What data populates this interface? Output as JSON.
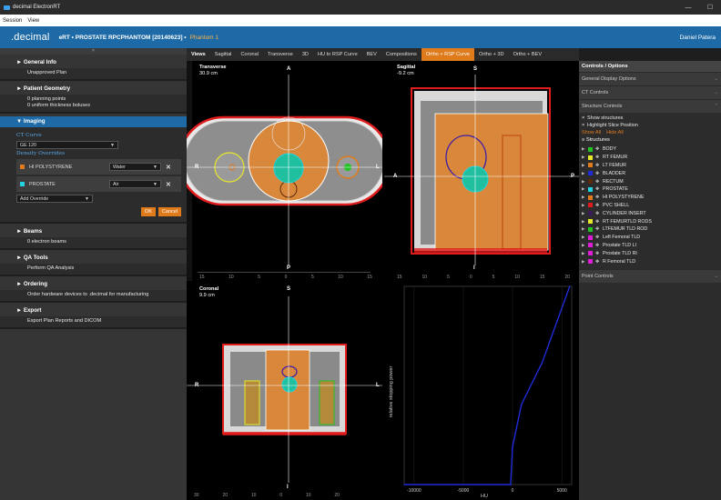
{
  "window": {
    "title": "decimal ElectronRT",
    "min": "—",
    "max": "☐"
  },
  "menu": [
    "Session",
    "View"
  ],
  "appbar": {
    "logo": ".decimal",
    "breadcrumb": "eRT  •  PROSTATE RPCPHANTOM [20140623]  •",
    "phantom": "Phantom 1",
    "user": "Daniel Patera"
  },
  "sidebar": {
    "general_info": {
      "title": "General Info",
      "body": "Unapproved Plan"
    },
    "patient_geometry": {
      "title": "Patient Geometry",
      "lines": [
        "0 planning points",
        "0 uniform thickness boluses"
      ]
    },
    "imaging": {
      "title": "Imaging",
      "ct_curve_label": "CT Curve",
      "ct_curve_value": "GE 120",
      "density_label": "Density Overrides",
      "overrides": [
        {
          "name": "HI POLYSTYRENE",
          "color": "#e07b1c",
          "value": "Water"
        },
        {
          "name": "PROSTATE",
          "color": "#22d3e0",
          "value": "Air"
        }
      ],
      "add_override": "Add Override",
      "ok": "OK",
      "cancel": "Cancel"
    },
    "beams": {
      "title": "Beams",
      "body": "0 electron beams"
    },
    "qa_tools": {
      "title": "QA Tools",
      "body": "Perform QA Analysis"
    },
    "ordering": {
      "title": "Ordering",
      "body": "Order hardware devices to .decimal for manufacturing"
    },
    "export": {
      "title": "Export",
      "body": "Export Plan Reports and DICOM"
    }
  },
  "tabs": [
    "Views",
    "Sagittal",
    "Coronal",
    "Transverse",
    "3D",
    "HU to RSP Curve",
    "BEV",
    "Compositions",
    "Ortho + RSP Curve",
    "Ortho + 3D",
    "Ortho + BEV"
  ],
  "active_tab": "Ortho + RSP Curve",
  "panes": {
    "transverse": {
      "name": "Transverse",
      "pos": "30.9 cm",
      "top": "A",
      "bottom": "P",
      "left": "R",
      "right": "L"
    },
    "sagittal": {
      "name": "Sagittal",
      "pos": "-9.2 cm",
      "top": "S",
      "bottom": "I",
      "left": "A",
      "right": "P"
    },
    "coronal": {
      "name": "Coronal",
      "pos": "9.9 cm",
      "top": "S",
      "bottom": "I",
      "left": "R",
      "right": "L"
    }
  },
  "transverse_ticks": [
    "15",
    "10",
    "5",
    "0",
    "5",
    "10",
    "15"
  ],
  "sagittal_ticks": [
    "15",
    "10",
    "5",
    "0",
    "5",
    "10",
    "15",
    "20"
  ],
  "coronal_ticks": [
    "30",
    "20",
    "10",
    "0",
    "10",
    "20"
  ],
  "chart_data": {
    "type": "line",
    "xlabel": "HU",
    "ylabel": "relative stopping power",
    "xticks": [
      "-10000",
      "-5000",
      "0",
      "5000"
    ],
    "x": [
      -11000,
      -200,
      0,
      900,
      3000,
      5800
    ],
    "y": [
      0.0,
      0.0,
      0.5,
      1.05,
      1.6,
      2.6
    ],
    "xlim": [
      -11000,
      6000
    ],
    "ylim": [
      0,
      2.6
    ],
    "color": "#1f2bd6"
  },
  "right_panel": {
    "title": "Controls / Options",
    "general_display": "General Display Options",
    "ct_controls": "CT Controls",
    "structure_controls": "Structure Controls",
    "show_structures": "Show structures",
    "highlight": "Highlight Slice Position",
    "show_all": "Show All",
    "hide_all": "Hide All",
    "structures_label": "Structures",
    "structures": [
      {
        "name": "BODY",
        "color": "#22c322"
      },
      {
        "name": "RT FEMUR",
        "color": "#e8e82a"
      },
      {
        "name": "LT FEMUR",
        "color": "#e07b1c"
      },
      {
        "name": "BLADDER",
        "color": "#1f2bd6"
      },
      {
        "name": "RECTUM",
        "color": "#5a2a0a"
      },
      {
        "name": "PROSTATE",
        "color": "#22d3e0"
      },
      {
        "name": "HI POLYSTYRENE",
        "color": "#e07b1c"
      },
      {
        "name": "PVC SHELL",
        "color": "#e01c1c"
      },
      {
        "name": "CYLINDER INSERT",
        "color": "#3a1a5a"
      },
      {
        "name": "RT FEMURTLD RODS",
        "color": "#e8e82a"
      },
      {
        "name": "LTFEMUR TLD ROD",
        "color": "#22c322"
      },
      {
        "name": "Left Femoral TLD",
        "color": "#e01cd8"
      },
      {
        "name": "Prostate TLD LI",
        "color": "#e01cd8"
      },
      {
        "name": "Prostate TLD RI",
        "color": "#e01cd8"
      },
      {
        "name": "R Femoral TLD",
        "color": "#e01cd8"
      }
    ],
    "point_controls": "Point Controls"
  }
}
